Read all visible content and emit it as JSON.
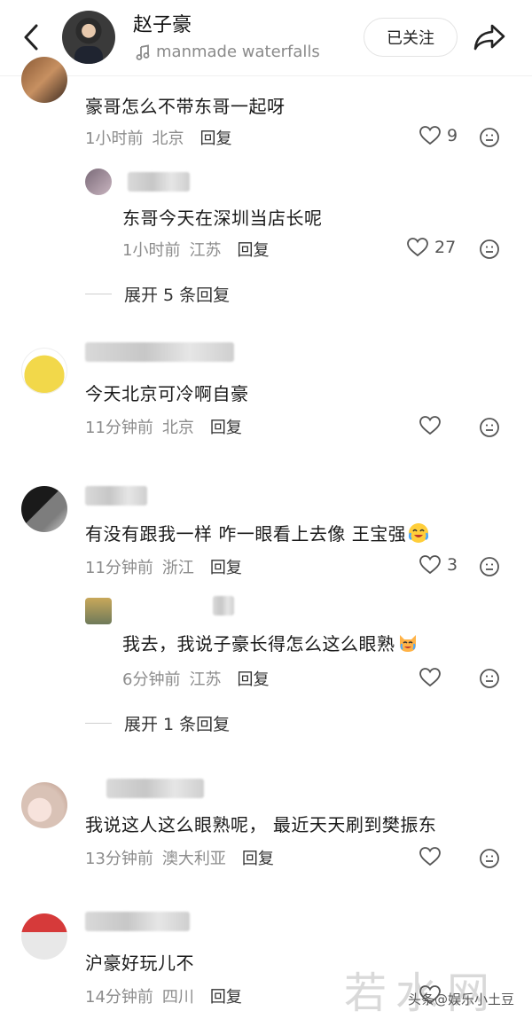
{
  "header": {
    "username": "赵子豪",
    "music": "manmade waterfalls",
    "follow_label": "已关注"
  },
  "comments": [
    {
      "text": "豪哥怎么不带东哥一起呀",
      "time": "1小时前",
      "location": "北京",
      "reply": "回复",
      "likes": "9",
      "replies": [
        {
          "text": "东哥今天在深圳当店长呢",
          "time": "1小时前",
          "location": "江苏",
          "reply": "回复",
          "likes": "27"
        }
      ],
      "expand": "展开 5 条回复"
    },
    {
      "text": "今天北京可冷啊自豪",
      "time": "11分钟前",
      "location": "北京",
      "reply": "回复",
      "likes": ""
    },
    {
      "text": "有没有跟我一样 咋一眼看上去像 王宝强",
      "time": "11分钟前",
      "location": "浙江",
      "reply": "回复",
      "likes": "3",
      "replies": [
        {
          "text": "我去，我说子豪长得怎么这么眼熟",
          "time": "6分钟前",
          "location": "江苏",
          "reply": "回复",
          "likes": ""
        }
      ],
      "expand": "展开 1 条回复"
    },
    {
      "text": "我说这人这么眼熟呢， 最近天天刷到樊振东",
      "time": "13分钟前",
      "location": "澳大利亚",
      "reply": "回复",
      "likes": ""
    },
    {
      "text": "沪豪好玩儿不",
      "time": "14分钟前",
      "location": "四川",
      "reply": "回复",
      "likes": ""
    }
  ],
  "watermark": "若水网",
  "source": "头条@娱乐小土豆",
  "icons": {
    "back": "chevron-left-icon",
    "music": "music-note-icon",
    "share": "share-arrow-icon",
    "like": "heart-outline-icon",
    "emoji": "emoji-face-icon"
  }
}
